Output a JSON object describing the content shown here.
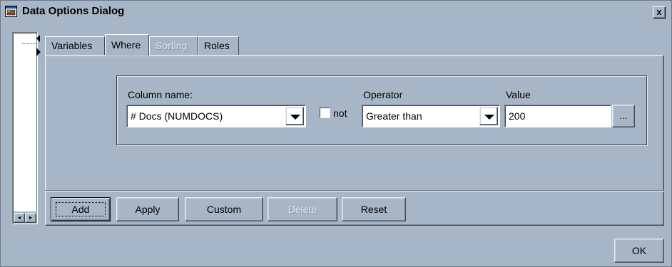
{
  "window": {
    "title": "Data Options Dialog",
    "close_glyph": "x",
    "icon": "dialog-window-icon"
  },
  "tabs": [
    {
      "label": "Variables",
      "active": false,
      "enabled": true
    },
    {
      "label": "Where",
      "active": true,
      "enabled": true
    },
    {
      "label": "Sorting",
      "active": false,
      "enabled": false
    },
    {
      "label": "Roles",
      "active": false,
      "enabled": true
    }
  ],
  "where": {
    "column_label": "Column name:",
    "column_value": "# Docs (NUMDOCS)",
    "not_label": "not",
    "not_checked": false,
    "operator_label": "Operator",
    "operator_value": "Greater than",
    "value_label": "Value",
    "value_value": "200",
    "ellipsis_label": "..."
  },
  "buttons": {
    "add": "Add",
    "apply": "Apply",
    "custom": "Custom",
    "delete": "Delete",
    "reset": "Reset",
    "ok": "OK"
  },
  "colors": {
    "background": "#a7b6c6",
    "field": "#ffffff"
  }
}
